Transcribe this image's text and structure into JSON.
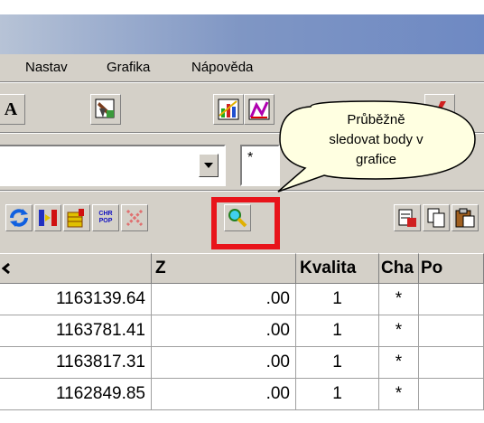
{
  "menu": {
    "items": [
      {
        "label": "Nastav"
      },
      {
        "label": "Grafika"
      },
      {
        "label": "Nápověda"
      }
    ]
  },
  "toolbar1": {
    "text_button_label": "A"
  },
  "filter": {
    "value": "",
    "mask_value": "*"
  },
  "tooltip": {
    "line1": "Průběžně",
    "line2": "sledovat body v",
    "line3": "grafice"
  },
  "toolbar2": {
    "chr_pop_icon_top": "CHR",
    "chr_pop_icon_bottom": "POP"
  },
  "colors": {
    "highlight": "#e8141b",
    "balloon": "#ffffe1",
    "titlebar_start": "#b7c3d6",
    "titlebar_end": "#6e89c3"
  },
  "table": {
    "columns": [
      "",
      "Z",
      "Kvalita",
      "Cha",
      "Po"
    ],
    "rows": [
      [
        "1163139.64",
        ".00",
        "1",
        "*",
        ""
      ],
      [
        "1163781.41",
        ".00",
        "1",
        "*",
        ""
      ],
      [
        "1163817.31",
        ".00",
        "1",
        "*",
        ""
      ],
      [
        "1162849.85",
        ".00",
        "1",
        "*",
        ""
      ]
    ]
  }
}
